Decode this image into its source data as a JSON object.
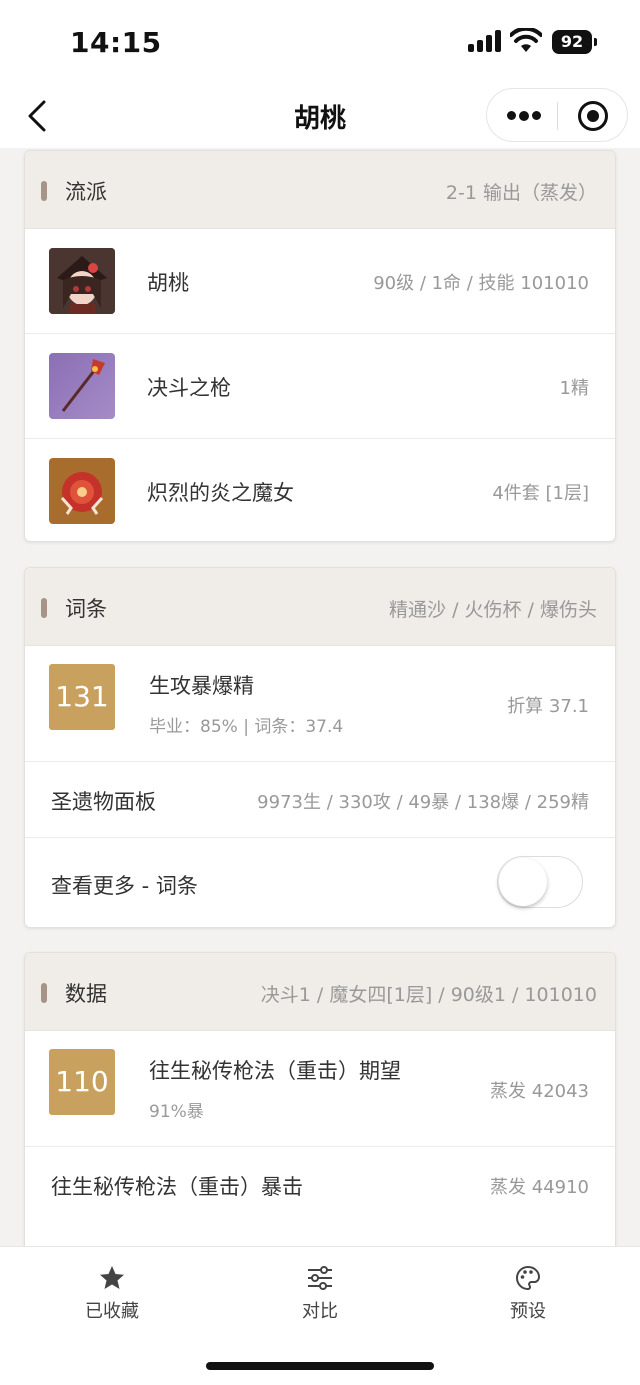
{
  "status": {
    "time": "14:15",
    "battery": "92"
  },
  "nav": {
    "title": "胡桃"
  },
  "sections": {
    "build": {
      "title": "流派",
      "right": "2-1 输出（蒸发）",
      "rows": [
        {
          "name": "胡桃",
          "value": "90级 / 1命 / 技能 101010"
        },
        {
          "name": "决斗之枪",
          "value": "1精"
        },
        {
          "name": "炽烈的炎之魔女",
          "value": "4件套 [1层]"
        }
      ]
    },
    "stats": {
      "title": "词条",
      "right": "精通沙 / 火伤杯 / 爆伤头",
      "score": "131",
      "score_name": "生攻暴爆精",
      "score_sub": "毕业：85% | 词条：37.4",
      "score_right": "折算 37.1",
      "panel_label": "圣遗物面板",
      "panel_value": "9973生 / 330攻 / 49暴 / 138爆 / 259精",
      "more_label": "查看更多 - 词条",
      "toggle_on": false
    },
    "data": {
      "title": "数据",
      "right": "决斗1 / 魔女四[1层] / 90级1 / 101010",
      "score": "110",
      "score_name": "往生秘传枪法（重击）期望",
      "score_sub": "91%暴",
      "score_right": "蒸发 42043",
      "row2_label": "往生秘传枪法（重击）暴击",
      "row2_value": "蒸发 44910"
    }
  },
  "tabs": [
    {
      "label": "已收藏",
      "icon": "star-icon"
    },
    {
      "label": "对比",
      "icon": "sliders-icon"
    },
    {
      "label": "预设",
      "icon": "palette-icon"
    }
  ],
  "colors": {
    "accent": "#c9a15e",
    "header_bg": "#f0ece7",
    "marker": "#a69488"
  }
}
